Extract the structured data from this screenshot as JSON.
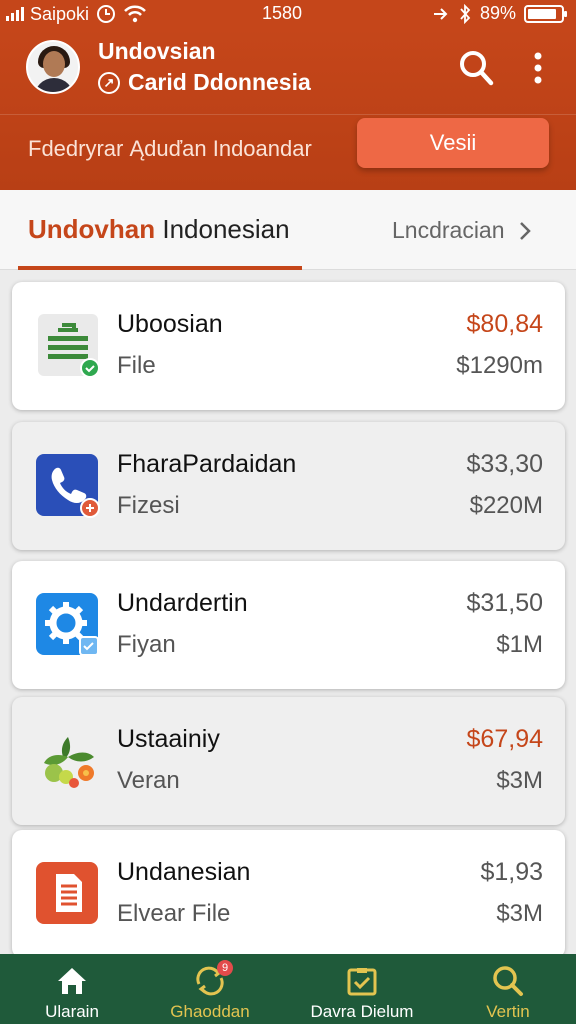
{
  "status_bar": {
    "carrier": "Saipoki",
    "time": "1580",
    "battery_text": "89%",
    "battery_level": 0.89
  },
  "header": {
    "user_name": "Undovsian",
    "user_subtitle": "Carid Ddonnesia",
    "banner_text": "Fdedryrar Ąduďan Indoandar",
    "cta_label": "Vesii"
  },
  "tabs": {
    "active_part1": "Undovhan",
    "active_part2": "Indonesian",
    "secondary": "Lncdracian"
  },
  "items": [
    {
      "title": "Uboosian",
      "subtitle": "File",
      "price": "$80,84",
      "size": "$1290m",
      "icon": "document-check-icon"
    },
    {
      "title": "FharaPardaidan",
      "subtitle": "Fizesi",
      "price": "$33,30",
      "size": "$220M",
      "icon": "phone-icon"
    },
    {
      "title": "Undardertin",
      "subtitle": "Fiyan",
      "price": "$31,50",
      "size": "$1M",
      "icon": "gear-icon"
    },
    {
      "title": "Ustaainiy",
      "subtitle": "Veran",
      "price": "$67,94",
      "size": "$3M",
      "icon": "plant-icon"
    },
    {
      "title": "Undanesian",
      "subtitle": "Elvear File",
      "price": "$1,93",
      "size": "$3M",
      "icon": "file-icon"
    }
  ],
  "bottom_nav": [
    {
      "label": "Ularain",
      "icon": "home-icon"
    },
    {
      "label": "Ghaoddan",
      "icon": "refresh-icon",
      "badge": "9"
    },
    {
      "label": "Davra Dielum",
      "icon": "checklist-icon"
    },
    {
      "label": "Vertin",
      "icon": "search-icon"
    }
  ],
  "colors": {
    "brand": "#c5461a",
    "accent_button": "#ee6845",
    "nav_bg": "#1f5a3a",
    "nav_gold": "#e3c450"
  }
}
